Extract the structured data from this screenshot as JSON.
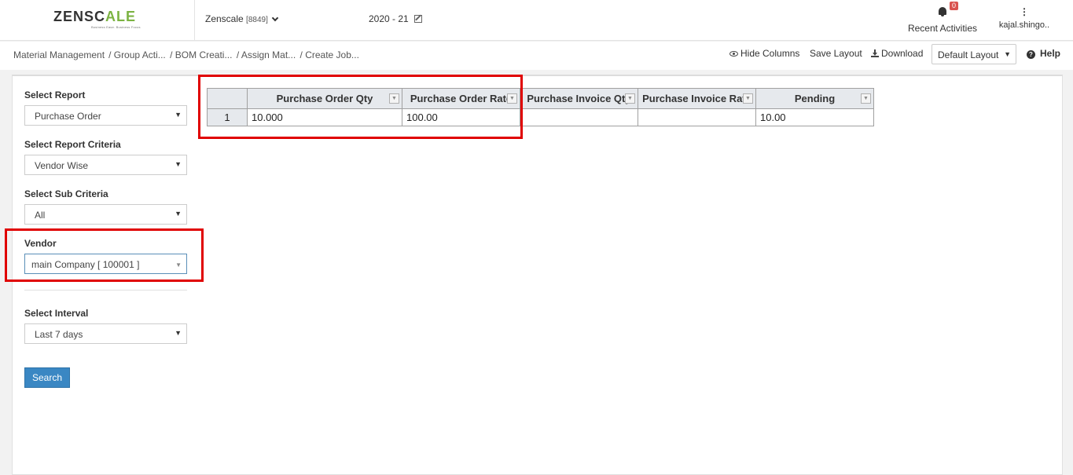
{
  "logo": {
    "part1": "ZENSC",
    "part2": "ALE",
    "tagline": "Business Ease. Business Focus"
  },
  "header": {
    "company": "Zenscale",
    "company_code": "[8849]",
    "year": "2020 - 21",
    "notifications_count": "0",
    "recent_label": "Recent Activities",
    "user_label": "kajal.shingo.."
  },
  "breadcrumb": {
    "items": [
      "Material Management",
      "/ Group Acti...",
      "/ BOM Creati...",
      "/ Assign Mat...",
      "/ Create Job..."
    ]
  },
  "toolbar": {
    "hide_columns": "Hide Columns",
    "save_layout": "Save Layout",
    "download": "Download",
    "layout_value": "Default Layout",
    "help": "Help"
  },
  "filters": {
    "report_label": "Select Report",
    "report_value": "Purchase Order",
    "criteria_label": "Select Report Criteria",
    "criteria_value": "Vendor Wise",
    "sub_label": "Select Sub Criteria",
    "sub_value": "All",
    "vendor_label": "Vendor",
    "vendor_value": "main Company [ 100001 ]",
    "interval_label": "Select Interval",
    "interval_value": "Last 7 days",
    "search_label": "Search"
  },
  "grid": {
    "columns": [
      "Purchase Order Qty",
      "Purchase Order Rate",
      "Purchase Invoice Qty",
      "Purchase Invoice Rate",
      "Pending"
    ],
    "rows": [
      {
        "num": "1",
        "cells": [
          "10.000",
          "100.00",
          "",
          "",
          "10.00"
        ]
      }
    ]
  }
}
